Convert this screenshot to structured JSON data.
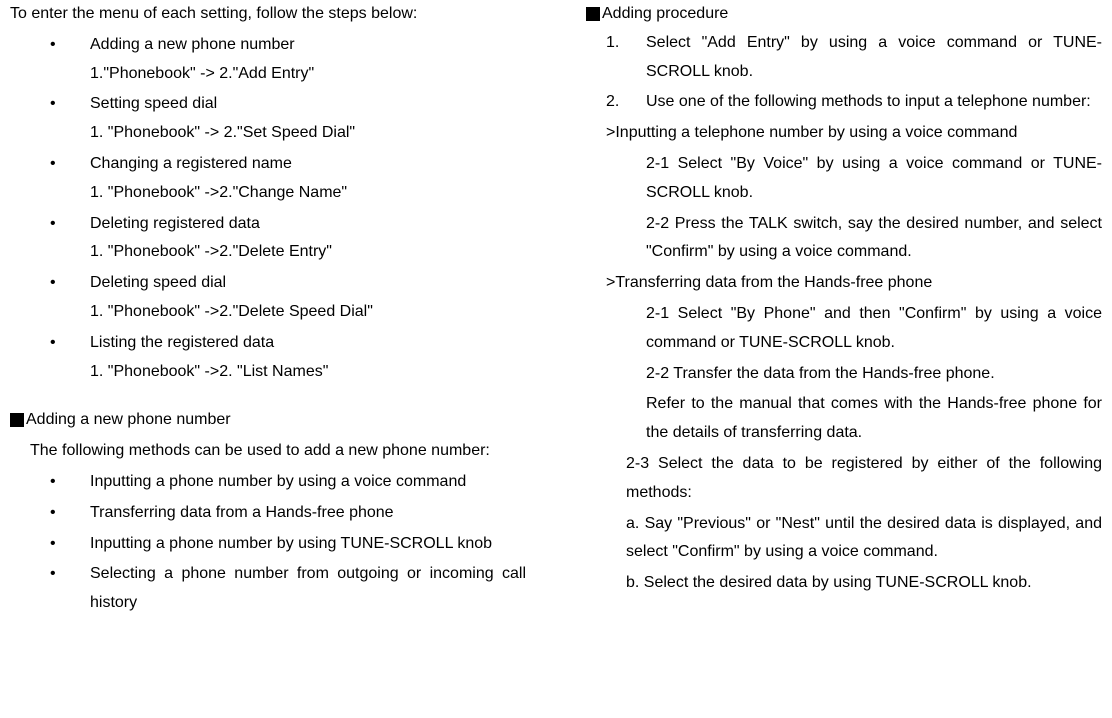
{
  "left": {
    "intro": "To enter the menu of each setting, follow the steps below:",
    "items": [
      {
        "title": "Adding a new phone number",
        "step": "1.\"Phonebook\" -> 2.\"Add Entry\""
      },
      {
        "title": "Setting speed dial",
        "step": "1. \"Phonebook\" -> 2.\"Set Speed Dial\""
      },
      {
        "title": "Changing a registered name",
        "step": "1. \"Phonebook\" ->2.\"Change Name\""
      },
      {
        "title": "Deleting registered data",
        "step": "1. \"Phonebook\" ->2.\"Delete Entry\""
      },
      {
        "title": "Deleting speed dial",
        "step": "1. \"Phonebook\" ->2.\"Delete Speed Dial\""
      },
      {
        "title": "Listing the registered data",
        "step": "1. \"Phonebook\" ->2. \"List Names\""
      }
    ],
    "section2_title": "Adding a new phone number",
    "section2_desc": "The following methods can be used to add a new phone number:",
    "section2_items": [
      "Inputting a phone number by using a voice command",
      "Transferring data from a Hands-free phone",
      "Inputting a phone number by using TUNE-SCROLL knob",
      "Selecting a phone number from outgoing or incoming call history"
    ]
  },
  "right": {
    "title": "Adding procedure",
    "step1": "Select \"Add Entry\" by using a voice command or TUNE-SCROLL knob.",
    "step2": "Use one of the following methods to input a telephone number:",
    "sub_a_title": ">Inputting a telephone number by using a voice command",
    "sub_a_1": "2-1 Select \"By Voice\" by using a voice command or TUNE-SCROLL knob.",
    "sub_a_2": "2-2 Press the TALK switch, say the desired number, and select \"Confirm\" by using a voice command.",
    "sub_b_title": ">Transferring data from the Hands-free phone",
    "sub_b_1": "2-1 Select \"By Phone\" and then \"Confirm\" by using a voice command or TUNE-SCROLL knob.",
    "sub_b_2": "2-2 Transfer the data from the Hands-free phone.",
    "sub_b_3": "Refer to the manual that comes with the Hands-free phone for the details of transferring data.",
    "sub_b_4": "2-3 Select the data to be registered by either of the following methods:",
    "sub_b_5": "a. Say \"Previous\" or \"Nest\" until the desired data is displayed, and select \"Confirm\" by using a voice command.",
    "sub_b_6": "b. Select the desired data by using TUNE-SCROLL knob."
  }
}
